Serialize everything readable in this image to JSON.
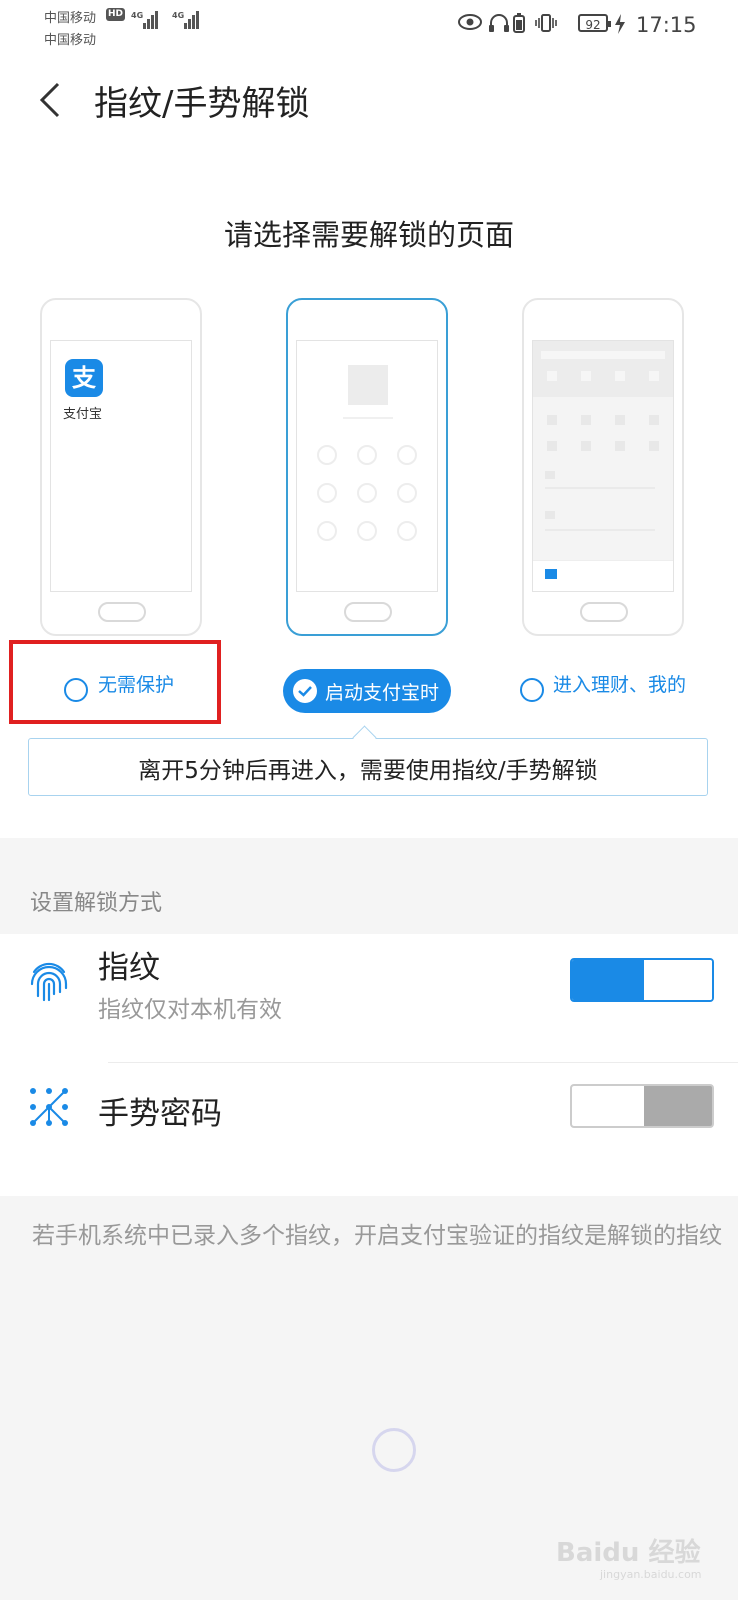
{
  "status_bar": {
    "carrier1": "中国移动",
    "carrier2": "中国移动",
    "hd": "HD",
    "net1": "4G",
    "net2": "4G",
    "battery": "92",
    "time": "17:15",
    "icons": [
      "eye-icon",
      "headphones-icon",
      "battery-small-icon",
      "vibrate-icon",
      "charging-icon"
    ]
  },
  "header": {
    "title": "指纹/手势解锁",
    "back_icon": "back-arrow-icon"
  },
  "page_picker": {
    "heading": "请选择需要解锁的页面",
    "phone1_app_label": "支付宝",
    "phone1_app_icon_glyph": "支",
    "options": [
      {
        "label": "无需保护",
        "selected": false
      },
      {
        "label": "启动支付宝时",
        "selected": true
      },
      {
        "label": "进入理财、我的",
        "selected": false
      }
    ],
    "tip": "离开5分钟后再进入，需要使用指纹/手势解锁"
  },
  "unlock_methods": {
    "section_title": "设置解锁方式",
    "fingerprint": {
      "title": "指纹",
      "subtitle": "指纹仅对本机有效",
      "enabled": true
    },
    "gesture": {
      "title": "手势密码",
      "enabled": false
    }
  },
  "footer_note": "若手机系统中已录入多个指纹，开启支付宝验证的指纹是解锁的指纹",
  "watermark": {
    "main": "Baidu 经验",
    "sub": "jingyan.baidu.com"
  },
  "colors": {
    "accent": "#1a8ae6",
    "highlight_box": "#e02020",
    "background": "#f5f5f5"
  }
}
